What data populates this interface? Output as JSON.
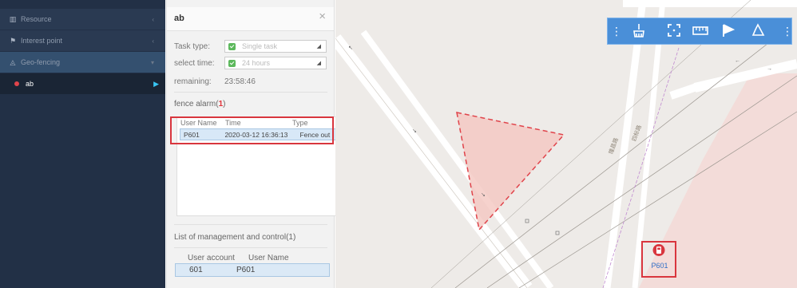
{
  "sidebar": {
    "items": [
      {
        "label": "Resource",
        "icon": "building-icon"
      },
      {
        "label": "Interest point",
        "icon": "flag-icon"
      },
      {
        "label": "Geo-fencing",
        "icon": "polygon-icon"
      },
      {
        "label": "ab",
        "icon": "red-dot-icon"
      }
    ]
  },
  "panel": {
    "title": "ab",
    "task_type_label": "Task type:",
    "task_type_value": "Single task",
    "select_time_label": "select time:",
    "select_time_value": "24 hours",
    "remaining_label": "remaining:",
    "remaining_value": "23:58:46",
    "fence_alarm_label": "fence alarm(",
    "fence_alarm_count": "1",
    "fence_alarm_close": ")",
    "alarm_table": {
      "headers": [
        "User Name",
        "Time",
        "Type"
      ],
      "rows": [
        {
          "user": "P601",
          "time": "2020-03-12 16:36:13",
          "type": "Fence out"
        }
      ]
    },
    "mgmt_title": "List of management and control(1)",
    "mgmt_table": {
      "headers": [
        "User account",
        "User Name"
      ],
      "rows": [
        {
          "account": "601",
          "name": "P601"
        }
      ]
    }
  },
  "map": {
    "device_label": "P601",
    "road_labels": [
      "隆昌路",
      "四标路"
    ],
    "toolbar_icons": [
      "broom-icon",
      "fullscreen-icon",
      "ruler-icon",
      "flag-icon",
      "polygon-draw-icon"
    ]
  },
  "colors": {
    "sidebar_bg": "#223046",
    "toolbar_bg": "#4a8fd8",
    "alert_red": "#d9363e",
    "fence_fill": "#f4c7c0"
  }
}
